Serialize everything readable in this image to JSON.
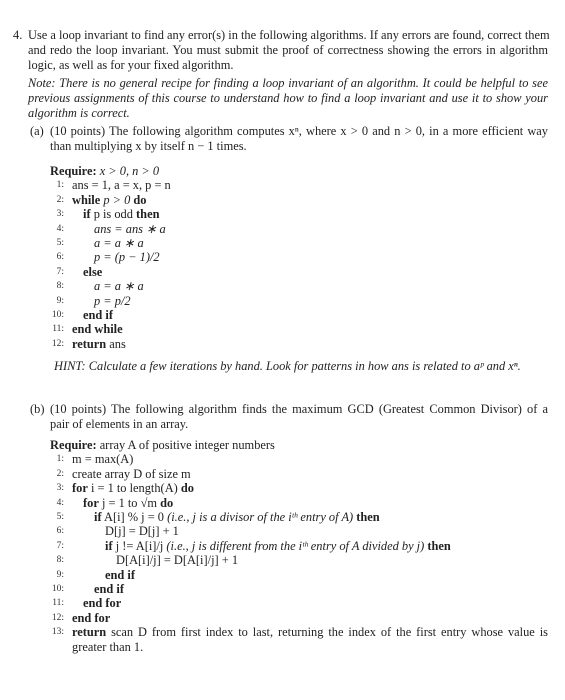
{
  "question": {
    "number": "4.",
    "intro_lines": [
      "Use a loop invariant to find any error(s) in the following algorithms. If any errors are found, correct them",
      "and redo the loop invariant. You must submit the proof of correctness showing the errors in algorithm",
      "logic, as well as for your fixed algorithm."
    ],
    "note_lines": [
      "Note: There is no general recipe for finding a loop invariant of an algorithm. It could be helpful to see",
      "previous assignments of this course to understand how to find a loop invariant and use it to show your",
      "algorithm is correct."
    ]
  },
  "part_a": {
    "label": "(a)",
    "desc_lines": [
      "(10 points) The following algorithm computes xⁿ, where x > 0 and n > 0, in a more efficient way",
      "than multiplying x by itself n − 1 times."
    ],
    "require_label": "Require:",
    "require_text": "x > 0, n > 0",
    "lines": [
      {
        "num": "1:",
        "indent": 0,
        "text": "ans = 1, a = x, p = n"
      },
      {
        "num": "2:",
        "indent": 0,
        "kw1": "while",
        "text": "p > 0",
        "kw2": "do"
      },
      {
        "num": "3:",
        "indent": 1,
        "kw1": "if",
        "text": "p is odd",
        "kw2": "then"
      },
      {
        "num": "4:",
        "indent": 2,
        "text": "ans = ans ∗ a"
      },
      {
        "num": "5:",
        "indent": 2,
        "text": "a = a ∗ a"
      },
      {
        "num": "6:",
        "indent": 2,
        "text": "p = (p − 1)/2"
      },
      {
        "num": "7:",
        "indent": 1,
        "kw1": "else"
      },
      {
        "num": "8:",
        "indent": 2,
        "text": "a = a ∗ a"
      },
      {
        "num": "9:",
        "indent": 2,
        "text": "p = p/2"
      },
      {
        "num": "10:",
        "indent": 1,
        "kw1": "end if"
      },
      {
        "num": "11:",
        "indent": 0,
        "kw1": "end while"
      },
      {
        "num": "12:",
        "indent": 0,
        "kw1": "return",
        "text": "ans"
      }
    ],
    "hint": "HINT: Calculate a few iterations by hand. Look for patterns in how ans is related to aᵖ and xⁿ."
  },
  "part_b": {
    "label": "(b)",
    "desc_lines": [
      "(10 points) The following algorithm finds the maximum GCD (Greatest Common Divisor) of a",
      "pair of elements in an array."
    ],
    "require_label": "Require:",
    "require_text": "array A of positive integer numbers",
    "lines": [
      {
        "num": "1:",
        "indent": 0,
        "text": "m = max(A)"
      },
      {
        "num": "2:",
        "indent": 0,
        "text": "create array D of size m"
      },
      {
        "num": "3:",
        "indent": 0,
        "kw1": "for",
        "text": "i = 1 to length(A)",
        "kw2": "do"
      },
      {
        "num": "4:",
        "indent": 1,
        "kw1": "for",
        "text": "j = 1 to √m",
        "kw2": "do"
      },
      {
        "num": "5:",
        "indent": 2,
        "kw1": "if",
        "text": "A[i] % j = 0",
        "comment": "(i.e., j is a divisor of the iᵗʰ entry of A)",
        "kw2": "then"
      },
      {
        "num": "6:",
        "indent": 3,
        "text": "D[j] = D[j] + 1"
      },
      {
        "num": "7:",
        "indent": 3,
        "kw1": "if",
        "text": "j != A[i]/j",
        "comment": "(i.e., j is different from the iᵗʰ entry of A divided by j)",
        "kw2": "then"
      },
      {
        "num": "8:",
        "indent": 4,
        "text": "D[A[i]/j] = D[A[i]/j] + 1"
      },
      {
        "num": "9:",
        "indent": 3,
        "kw1": "end if"
      },
      {
        "num": "10:",
        "indent": 2,
        "kw1": "end if"
      },
      {
        "num": "11:",
        "indent": 1,
        "kw1": "end for"
      },
      {
        "num": "12:",
        "indent": 0,
        "kw1": "end for"
      },
      {
        "num": "13:",
        "indent": 0,
        "kw1": "return",
        "text": "scan D from first index to last, returning the index of the first entry whose value is",
        "cont": "greater than 1."
      }
    ]
  }
}
